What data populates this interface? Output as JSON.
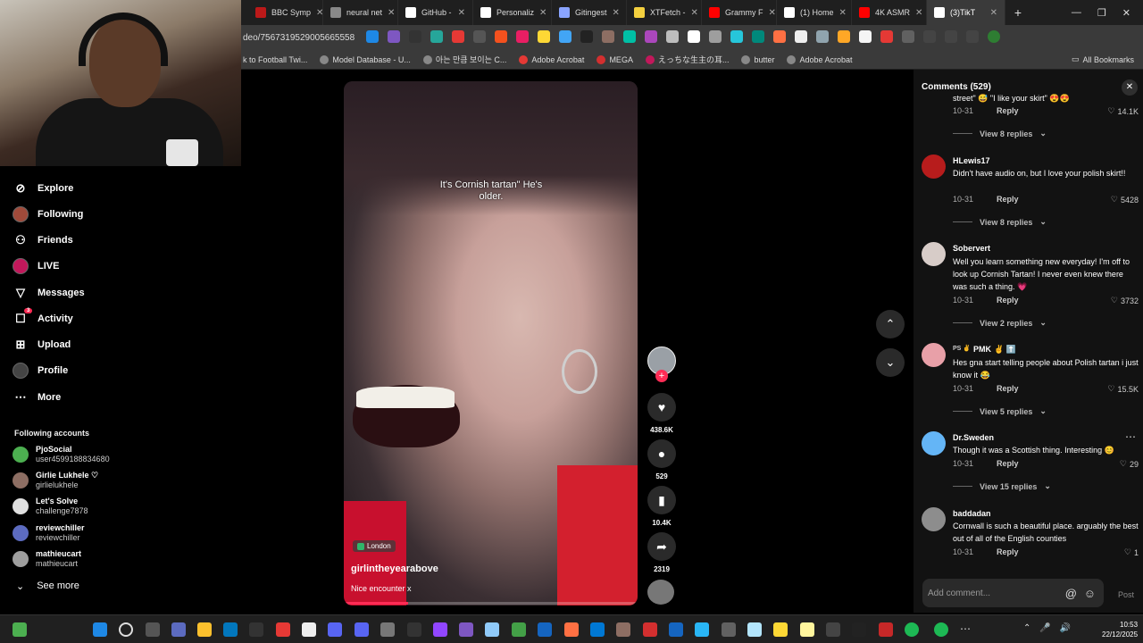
{
  "browser": {
    "tabs": [
      {
        "label": "BBC Symp",
        "color": "#bb1919"
      },
      {
        "label": "neural net",
        "color": "#888888"
      },
      {
        "label": "GitHub - ",
        "color": "#ffffff"
      },
      {
        "label": "Personaliz",
        "color": "#ffffff"
      },
      {
        "label": "Gitingest",
        "color": "#8aa4ff"
      },
      {
        "label": "XTFetch -",
        "color": "#f4d03f"
      },
      {
        "label": "Grammy F",
        "color": "#ff0000"
      },
      {
        "label": "(1) Home",
        "color": "#ffffff"
      },
      {
        "label": "4K ASMR",
        "color": "#ff0000"
      },
      {
        "label": "(3)TikT",
        "color": "#ffffff"
      }
    ],
    "new_tab": "+",
    "window_controls": [
      "—",
      "❐",
      "✕"
    ],
    "url": "deo/7567319529005665558",
    "bookmarks": [
      {
        "label": "k to Football Twi..."
      },
      {
        "label": "Model Database - U..."
      },
      {
        "label": "아는 만큼 보이는 C..."
      },
      {
        "label": "Adobe Acrobat"
      },
      {
        "label": "MEGA"
      },
      {
        "label": "えっちな生主の耳..."
      },
      {
        "label": "butter"
      },
      {
        "label": "Adobe Acrobat"
      }
    ],
    "all_bookmarks": "All Bookmarks"
  },
  "sidebar": {
    "nav": [
      {
        "label": "Explore",
        "icon": "compass-icon",
        "glyph": "⊘"
      },
      {
        "label": "Following",
        "icon": "avatar",
        "glyph": ""
      },
      {
        "label": "Friends",
        "icon": "friends-icon",
        "glyph": "👥"
      },
      {
        "label": "LIVE",
        "icon": "live-icon",
        "glyph": "◉"
      },
      {
        "label": "Messages",
        "icon": "messages-icon",
        "glyph": "▽"
      },
      {
        "label": "Activity",
        "icon": "activity-icon",
        "glyph": "☐",
        "badge": "3"
      },
      {
        "label": "Upload",
        "icon": "upload-icon",
        "glyph": "⊞"
      },
      {
        "label": "Profile",
        "icon": "profile-icon",
        "glyph": "●"
      },
      {
        "label": "More",
        "icon": "more-icon",
        "glyph": "⋯"
      }
    ],
    "following_title": "Following accounts",
    "accounts": [
      {
        "name": "PjoSocial",
        "handle": "user4599188834680",
        "color": "#4caf50"
      },
      {
        "name": "Girlie Lukhele ♡",
        "handle": "girlielukhele",
        "color": "#8d6e63"
      },
      {
        "name": "Let's Solve",
        "handle": "challenge7878",
        "color": "#e0e0e0"
      },
      {
        "name": "reviewchiller",
        "handle": "reviewchiller",
        "color": "#5c6bc0"
      },
      {
        "name": "mathieucart",
        "handle": "mathieucart",
        "color": "#9e9e9e"
      }
    ],
    "see_more": "See more"
  },
  "video": {
    "caption": "It's Cornish tartan\" He's older.",
    "location": "London",
    "author": "girlintheyearabove",
    "description": "Nice encounter x",
    "progress": 0.22
  },
  "actions": {
    "likes": "438.6K",
    "comments": "529",
    "saves": "10.4K",
    "shares": "2319"
  },
  "comments_panel": {
    "title": "Comments (529)",
    "items": [
      {
        "user": "",
        "text": "street\" 😅 \"I like your skirt\" 😍😍",
        "date": "10-31",
        "reply": "Reply",
        "likes": "14.1K",
        "view_replies": "View 8 replies",
        "avatar": ""
      },
      {
        "user": "HLewis17",
        "text": "Didn't have audio on, but I love your polish skirt!!",
        "date": "10-31",
        "reply": "Reply",
        "likes": "5428",
        "view_replies": "View 8 replies",
        "avatar": "#b71c1c"
      },
      {
        "user": "Sobervert",
        "text": "Well you learn something new everyday! I'm off to look up Cornish Tartan! I never even knew there was such a thing. 💗",
        "date": "10-31",
        "reply": "Reply",
        "likes": "3732",
        "view_replies": "View 2 replies",
        "avatar": "#d7ccc8"
      },
      {
        "user": "PMK",
        "text": "Hes gna start telling people about Polish tartan i just know it 😂",
        "date": "10-31",
        "reply": "Reply",
        "likes": "15.5K",
        "view_replies": "View 5 replies",
        "avatar": "#e8a0a8",
        "prefix": "PS ✌️",
        "suffix": "✌️ ⬆️"
      },
      {
        "user": "Dr.Sweden",
        "text": "Though it was a Scottish thing. Interesting 😊",
        "date": "10-31",
        "reply": "Reply",
        "likes": "29",
        "view_replies": "View 15 replies",
        "avatar": "#64b5f6"
      },
      {
        "user": "baddadan",
        "text": "Cornwall is such a beautiful place. arguably the best out of all of the English counties",
        "date": "10-31",
        "reply": "Reply",
        "likes": "1",
        "view_replies": "",
        "avatar": "#8d8d8d"
      }
    ],
    "input_placeholder": "Add comment...",
    "post": "Post"
  },
  "taskbar": {
    "time": "10:53",
    "date": "22/12/2025"
  }
}
